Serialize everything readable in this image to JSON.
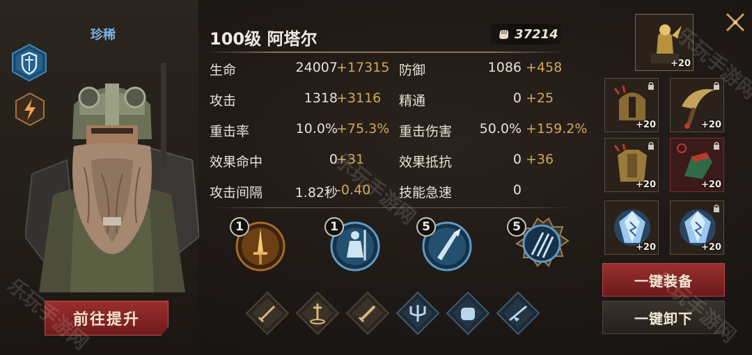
{
  "hero": {
    "rarity": "珍稀",
    "title": "100级  阿塔尔",
    "power": "37214",
    "upgrade_label": "前往提升"
  },
  "stats": [
    {
      "label": "生命",
      "base": "24007",
      "bonus": "+17315"
    },
    {
      "label": "攻击",
      "base": "1318",
      "bonus": "+3116"
    },
    {
      "label": "重击率",
      "base": "10.0%",
      "bonus": "+75.3%"
    },
    {
      "label": "效果命中",
      "base": "0",
      "bonus": "+31"
    },
    {
      "label": "攻击间隔",
      "base": "1.82秒",
      "bonus": "-0.40"
    },
    {
      "label": "防御",
      "base": "1086",
      "bonus": "+458"
    },
    {
      "label": "精通",
      "base": "0",
      "bonus": "+25"
    },
    {
      "label": "重击伤害",
      "base": "50.0%",
      "bonus": "+159.2%"
    },
    {
      "label": "效果抵抗",
      "base": "0",
      "bonus": "+36"
    },
    {
      "label": "技能急速",
      "base": "0",
      "bonus": ""
    }
  ],
  "skills": [
    {
      "level": "1",
      "icon": "golden-sword-skill-icon"
    },
    {
      "level": "1",
      "icon": "knight-stance-skill-icon"
    },
    {
      "level": "5",
      "icon": "spear-strike-skill-icon"
    },
    {
      "level": "5",
      "icon": "triple-spear-skill-icon"
    }
  ],
  "talents": [
    "sword-talent-icon",
    "planted-sword-talent-icon",
    "sword-slash-talent-icon",
    "trident-talent-icon",
    "fist-talent-icon",
    "spear-rush-talent-icon"
  ],
  "equipment": {
    "featured": {
      "level": "+20"
    },
    "slots": [
      {
        "level": "+20",
        "locked": true,
        "icon": "helmet-icon"
      },
      {
        "level": "+20",
        "locked": true,
        "icon": "axe-blade-icon"
      },
      {
        "level": "+20",
        "locked": true,
        "icon": "armor-icon"
      },
      {
        "level": "+20",
        "locked": true,
        "icon": "gauntlet-icon"
      },
      {
        "level": "+20",
        "locked": false,
        "icon": "crystal-icon"
      },
      {
        "level": "+20",
        "locked": true,
        "icon": "crystal-icon"
      }
    ],
    "equip_all_label": "一键装备",
    "unequip_all_label": "一键卸下"
  },
  "watermark": "乐玩手游网",
  "colors": {
    "bonus": "#d4a85a",
    "rarity": "#7fb2e6",
    "accent_red": "#9b2f2f"
  }
}
